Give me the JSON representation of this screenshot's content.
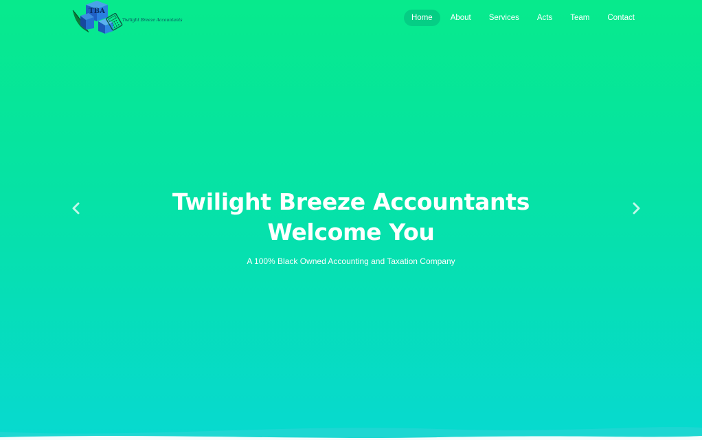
{
  "header": {
    "logo": {
      "monogram": "TBA",
      "tagline": "Twilight Breeze Accountants"
    },
    "nav": {
      "items": [
        {
          "label": "Home",
          "active": true
        },
        {
          "label": "About",
          "active": false
        },
        {
          "label": "Services",
          "active": false
        },
        {
          "label": "Acts",
          "active": false
        },
        {
          "label": "Team",
          "active": false
        },
        {
          "label": "Contact",
          "active": false
        }
      ]
    }
  },
  "hero": {
    "title_line1": "Twilight Breeze Accountants",
    "title_line2": "Welcome You",
    "subtitle": "A 100% Black Owned Accounting and Taxation Company",
    "prev_icon": "chevron-left-icon",
    "next_icon": "chevron-right-icon"
  },
  "colors": {
    "gradient_top": "#07ea8c",
    "gradient_bottom": "#07d9d0",
    "text": "#ffffff",
    "active_nav_bg": "rgba(0,110,100,0.22)"
  }
}
